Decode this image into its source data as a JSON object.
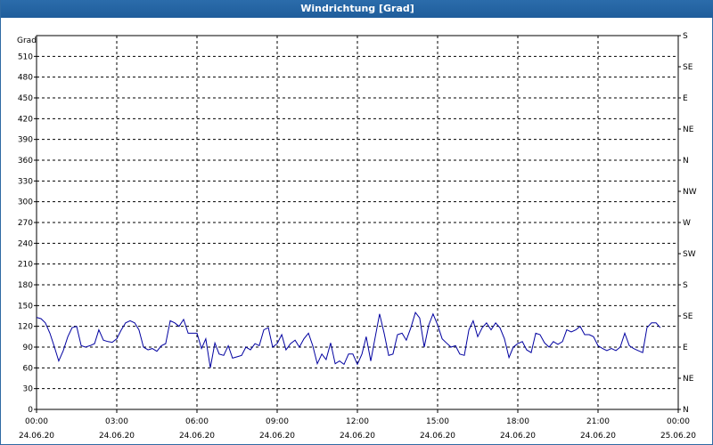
{
  "window": {
    "title": "Windrichtung [Grad]"
  },
  "chart_data": {
    "type": "line",
    "title": "Windrichtung [Grad]",
    "ylabel": "Grad",
    "xlabel": "",
    "ylim": [
      0,
      540
    ],
    "xlim_hours": [
      0,
      24
    ],
    "grid": true,
    "y_ticks": [
      0,
      30,
      60,
      90,
      120,
      150,
      180,
      210,
      240,
      270,
      300,
      330,
      360,
      390,
      420,
      450,
      480,
      510
    ],
    "y_right_ticks": [
      {
        "value": 0,
        "label": "N"
      },
      {
        "value": 45,
        "label": "NE"
      },
      {
        "value": 90,
        "label": "E"
      },
      {
        "value": 135,
        "label": "SE"
      },
      {
        "value": 180,
        "label": "S"
      },
      {
        "value": 225,
        "label": "SW"
      },
      {
        "value": 270,
        "label": "W"
      },
      {
        "value": 315,
        "label": "NW"
      },
      {
        "value": 360,
        "label": "N"
      },
      {
        "value": 405,
        "label": "NE"
      },
      {
        "value": 450,
        "label": "E"
      },
      {
        "value": 495,
        "label": "SE"
      },
      {
        "value": 540,
        "label": "S"
      }
    ],
    "x_ticks": [
      {
        "time": "00:00",
        "date": "24.06.20"
      },
      {
        "time": "03:00",
        "date": "24.06.20"
      },
      {
        "time": "06:00",
        "date": "24.06.20"
      },
      {
        "time": "09:00",
        "date": "24.06.20"
      },
      {
        "time": "12:00",
        "date": "24.06.20"
      },
      {
        "time": "15:00",
        "date": "24.06.20"
      },
      {
        "time": "18:00",
        "date": "24.06.20"
      },
      {
        "time": "21:00",
        "date": "24.06.20"
      },
      {
        "time": "00:00",
        "date": "25.06.20"
      }
    ],
    "series": [
      {
        "color": "#0000a0",
        "x_hours": [
          0,
          0.17,
          0.33,
          0.5,
          0.67,
          0.83,
          1.0,
          1.17,
          1.33,
          1.5,
          1.67,
          1.83,
          2.0,
          2.17,
          2.33,
          2.5,
          2.67,
          2.83,
          3.0,
          3.17,
          3.33,
          3.5,
          3.67,
          3.83,
          4.0,
          4.17,
          4.33,
          4.5,
          4.67,
          4.83,
          5.0,
          5.17,
          5.33,
          5.5,
          5.67,
          5.83,
          6.0,
          6.17,
          6.33,
          6.5,
          6.67,
          6.83,
          7.0,
          7.17,
          7.33,
          7.5,
          7.67,
          7.83,
          8.0,
          8.17,
          8.33,
          8.5,
          8.67,
          8.83,
          9.0,
          9.17,
          9.33,
          9.5,
          9.67,
          9.83,
          10.0,
          10.17,
          10.33,
          10.5,
          10.67,
          10.83,
          11.0,
          11.17,
          11.33,
          11.5,
          11.67,
          11.83,
          12.0,
          12.17,
          12.33,
          12.5,
          12.67,
          12.83,
          13.0,
          13.17,
          13.33,
          13.5,
          13.67,
          13.83,
          14.0,
          14.17,
          14.33,
          14.5,
          14.67,
          14.83,
          15.0,
          15.17,
          15.33,
          15.5,
          15.67,
          15.83,
          16.0,
          16.17,
          16.33,
          16.5,
          16.67,
          16.83,
          17.0,
          17.17,
          17.33,
          17.5,
          17.67,
          17.83,
          18.0,
          18.17,
          18.33,
          18.5,
          18.67,
          18.83,
          19.0,
          19.17,
          19.33,
          19.5,
          19.67,
          19.83,
          20.0,
          20.17,
          20.33,
          20.5,
          20.67,
          20.83,
          21.0,
          21.17,
          21.33,
          21.5,
          21.67,
          21.83,
          22.0,
          22.17,
          22.33,
          22.5,
          22.67,
          22.83,
          23.0,
          23.17,
          23.33,
          23.5,
          23.67,
          23.83,
          24.0
        ],
        "values": [
          133,
          131,
          125,
          110,
          90,
          70,
          85,
          105,
          118,
          120,
          92,
          90,
          92,
          95,
          115,
          100,
          98,
          97,
          102,
          115,
          125,
          128,
          125,
          115,
          90,
          86,
          88,
          84,
          92,
          95,
          128,
          125,
          120,
          130,
          110,
          110,
          110,
          88,
          102,
          60,
          96,
          80,
          78,
          92,
          74,
          76,
          78,
          90,
          86,
          95,
          92,
          115,
          118,
          90,
          95,
          108,
          86,
          95,
          100,
          90,
          102,
          110,
          92,
          66,
          80,
          72,
          96,
          66,
          70,
          65,
          80,
          80,
          65,
          80,
          105,
          70,
          105,
          138,
          110,
          78,
          80,
          108,
          110,
          100,
          118,
          140,
          132,
          90,
          122,
          138,
          122,
          102,
          96,
          90,
          92,
          80,
          78,
          115,
          128,
          105,
          118,
          125,
          115,
          125,
          118,
          102,
          75,
          90,
          95,
          98,
          86,
          82,
          110,
          108,
          96,
          90,
          98,
          94,
          98,
          115,
          112,
          115,
          120,
          108,
          108,
          105,
          92,
          88,
          85,
          88,
          85,
          90,
          110,
          92,
          88,
          85,
          82,
          118,
          125,
          125,
          118
        ]
      }
    ]
  }
}
